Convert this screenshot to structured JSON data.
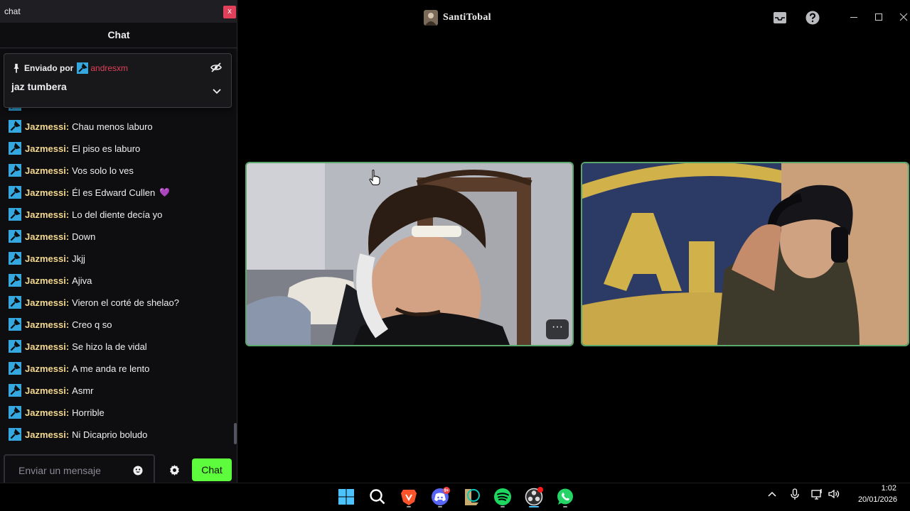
{
  "chat_window": {
    "window_title": "chat",
    "close_glyph": "x",
    "header": "Chat",
    "pinned": {
      "sent_by_label": "Enviado por",
      "user": "andresxm",
      "message": "jaz tumbera",
      "icons": [
        "pin-icon",
        "eye-slash-icon",
        "chevron-down-icon"
      ]
    },
    "messages": [
      {
        "user": "Jazmessi",
        "text": "Chau menos laburo"
      },
      {
        "user": "Jazmessi",
        "text": "El piso es laburo"
      },
      {
        "user": "Jazmessi",
        "text": "Vos solo lo ves"
      },
      {
        "user": "Jazmessi",
        "text": "Él es Edward Cullen",
        "emoji": "💜"
      },
      {
        "user": "Jazmessi",
        "text": "Lo del diente decía yo"
      },
      {
        "user": "Jazmessi",
        "text": "Down"
      },
      {
        "user": "Jazmessi",
        "text": "Jkjj"
      },
      {
        "user": "Jazmessi",
        "text": "Ajiva"
      },
      {
        "user": "Jazmessi",
        "text": "Vieron el corté de shelao?"
      },
      {
        "user": "Jazmessi",
        "text": "Creo q so"
      },
      {
        "user": "Jazmessi",
        "text": "Se hizo la de vidal"
      },
      {
        "user": "Jazmessi",
        "text": "A me anda re lento"
      },
      {
        "user": "Jazmessi",
        "text": "Asmr"
      },
      {
        "user": "Jazmessi",
        "text": "Horrible"
      },
      {
        "user": "Jazmessi",
        "text": "Ni Dicaprio boludo"
      }
    ],
    "input_placeholder": "Enviar un mensaje",
    "send_button": "Chat",
    "colors": {
      "username": "#f4d88e",
      "pinned_user": "#e0405a",
      "send_button": "#5dfc3c",
      "badge": "#35a8e0"
    }
  },
  "call_window": {
    "title": "SantiTobal",
    "more_glyph": "···",
    "icons": [
      "inbox-icon",
      "help-icon",
      "minimize-icon",
      "maximize-icon",
      "close-icon"
    ],
    "tile_border_color": "#5aa86b"
  },
  "taskbar": {
    "apps": [
      "windows-start-icon",
      "search-icon",
      "brave-browser-icon",
      "discord-icon",
      "league-of-legends-icon",
      "spotify-icon",
      "obs-icon",
      "whatsapp-icon"
    ],
    "discord_badge": "9+",
    "tray_icons": [
      "chevron-up-icon",
      "microphone-icon",
      "network-icon",
      "volume-icon"
    ],
    "time": "1:02",
    "date": "20/01/2026"
  }
}
